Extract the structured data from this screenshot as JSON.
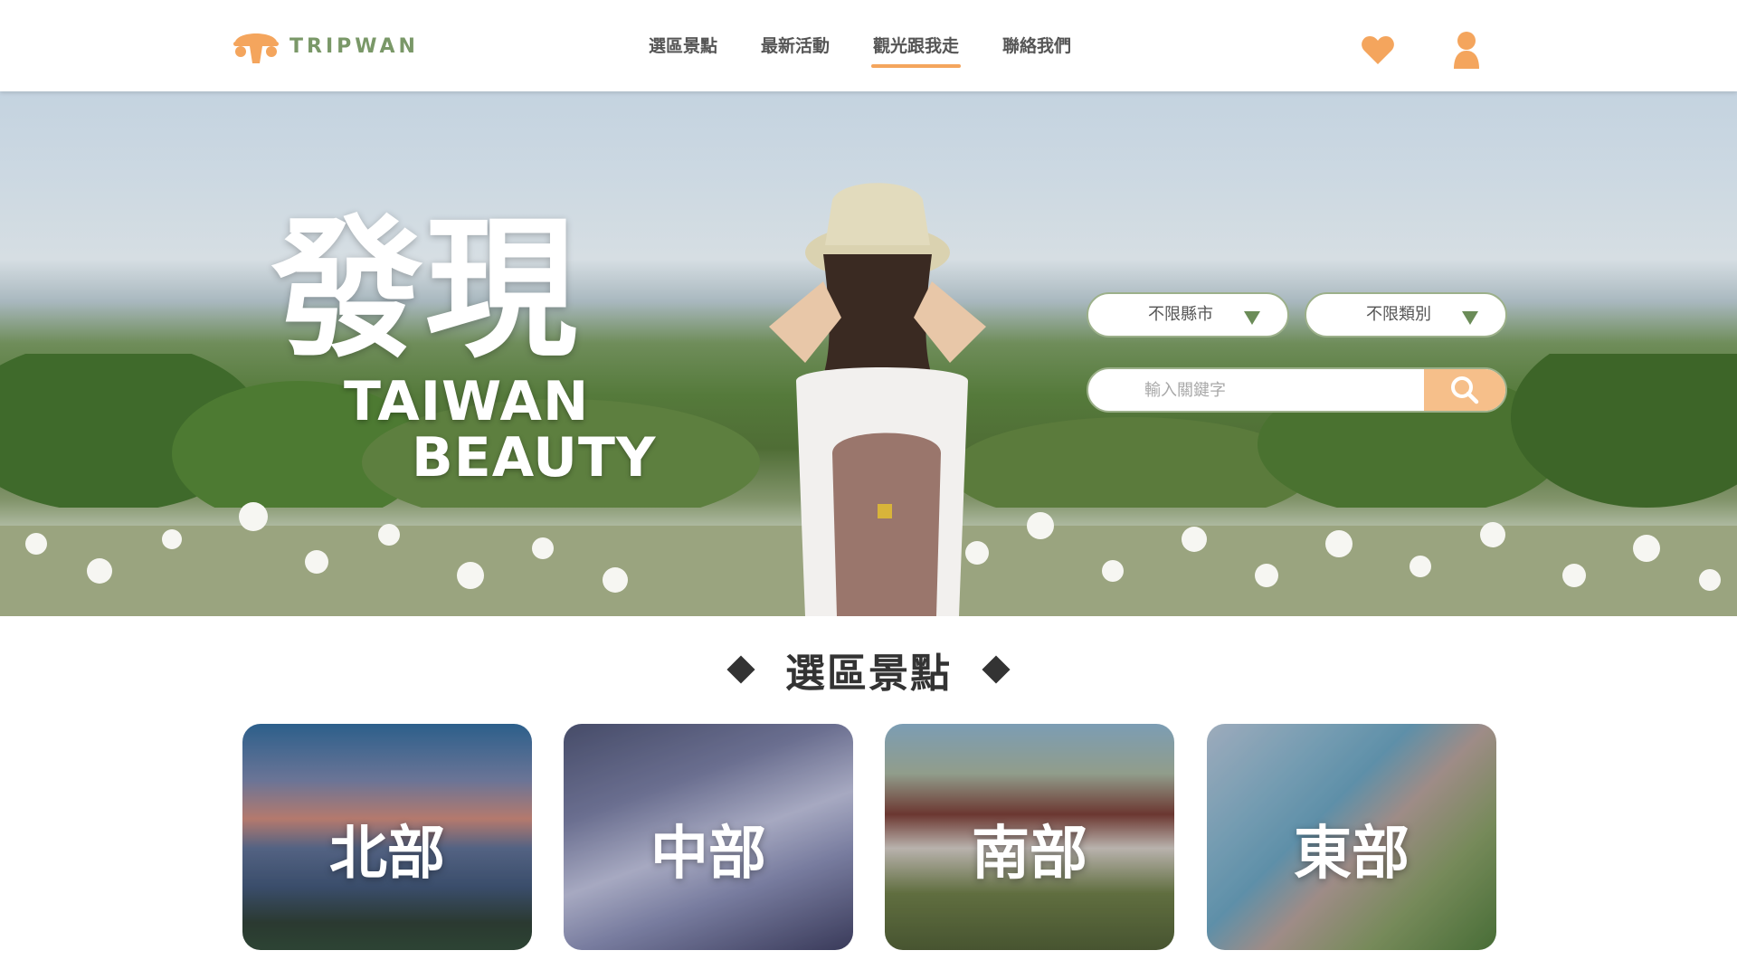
{
  "brand": {
    "name": "TRIPWAN",
    "logo_icon": "tripwan-logo-icon",
    "text_color": "#7a9868",
    "accent_color": "#f4a55d"
  },
  "nav": {
    "items": [
      {
        "label": "選區景點",
        "active": false
      },
      {
        "label": "最新活動",
        "active": false
      },
      {
        "label": "觀光跟我走",
        "active": true
      },
      {
        "label": "聯絡我們",
        "active": false
      }
    ]
  },
  "header_icons": {
    "favorite": "heart-icon",
    "account": "user-icon"
  },
  "hero": {
    "title": "發現",
    "subtitle_line1": "TAIWAN",
    "subtitle_line2": "BEAUTY",
    "filters": {
      "city": "不限縣市",
      "category": "不限類別"
    },
    "search": {
      "placeholder": "輸入關鍵字",
      "value": "",
      "button_icon": "search-icon"
    }
  },
  "section": {
    "title": "選區景點",
    "regions": [
      {
        "label": "北部"
      },
      {
        "label": "中部"
      },
      {
        "label": "南部"
      },
      {
        "label": "東部"
      }
    ]
  }
}
